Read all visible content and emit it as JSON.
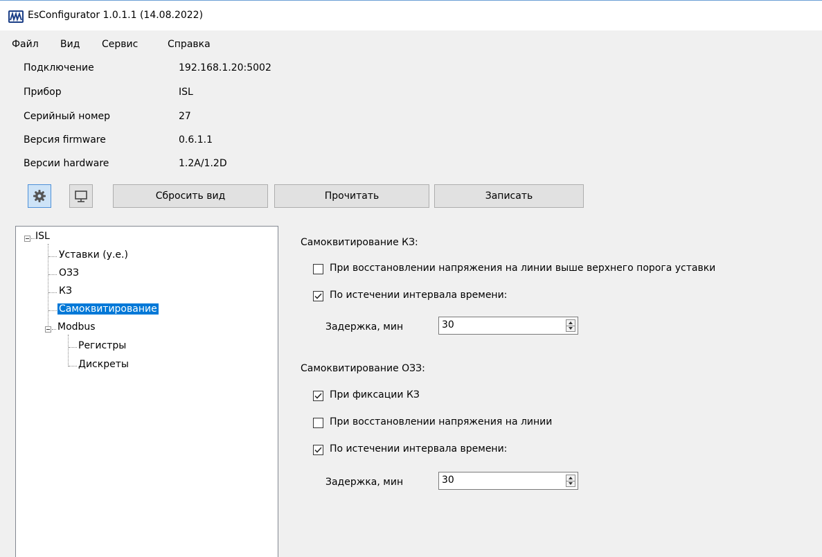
{
  "window": {
    "title": "EsConfigurator 1.0.1.1 (14.08.2022)"
  },
  "menu": {
    "items": [
      "Файл",
      "Вид",
      "Сервис",
      "Справка"
    ]
  },
  "device_info": {
    "connection_label": "Подключение",
    "connection_value": "192.168.1.20:5002",
    "device_label": "Прибор",
    "device_value": "ISL",
    "serial_label": "Серийный номер",
    "serial_value": "27",
    "firmware_label": "Версия firmware",
    "firmware_value": "0.6.1.1",
    "hardware_label": "Версии hardware",
    "hardware_value": "1.2A/1.2D"
  },
  "toolbar": {
    "settings_icon": "gear-icon",
    "monitor_icon": "monitor-icon",
    "reset_view_label": "Сбросить вид",
    "read_label": "Прочитать",
    "write_label": "Записать"
  },
  "tree": {
    "root": "ISL",
    "items": [
      "Уставки (у.е.)",
      "ОЗЗ",
      "КЗ",
      "Самоквитирование"
    ],
    "modbus": "Modbus",
    "modbus_items": [
      "Регистры",
      "Дискреты"
    ],
    "selected": "Самоквитирование"
  },
  "kz_section": {
    "title": "Самоквитирование КЗ:",
    "option_voltage_label": "При восстановлении напряжения на линии выше верхнего порога уставки",
    "option_voltage_checked": false,
    "option_interval_label": "По истечении интервала времени:",
    "option_interval_checked": true,
    "delay_label": "Задержка, мин",
    "delay_value": "30"
  },
  "ozz_section": {
    "title": "Самоквитирование ОЗЗ:",
    "option_kz_label": "При фиксации КЗ",
    "option_kz_checked": true,
    "option_voltage_label": "При восстановлении напряжения на линии",
    "option_voltage_checked": false,
    "option_interval_label": "По истечении интервала времени:",
    "option_interval_checked": true,
    "delay_label": "Задержка, мин",
    "delay_value": "30"
  },
  "colors": {
    "selection": "#0078d7",
    "active_button": "#cde3f7",
    "window_bg": "#f0f0f0"
  }
}
